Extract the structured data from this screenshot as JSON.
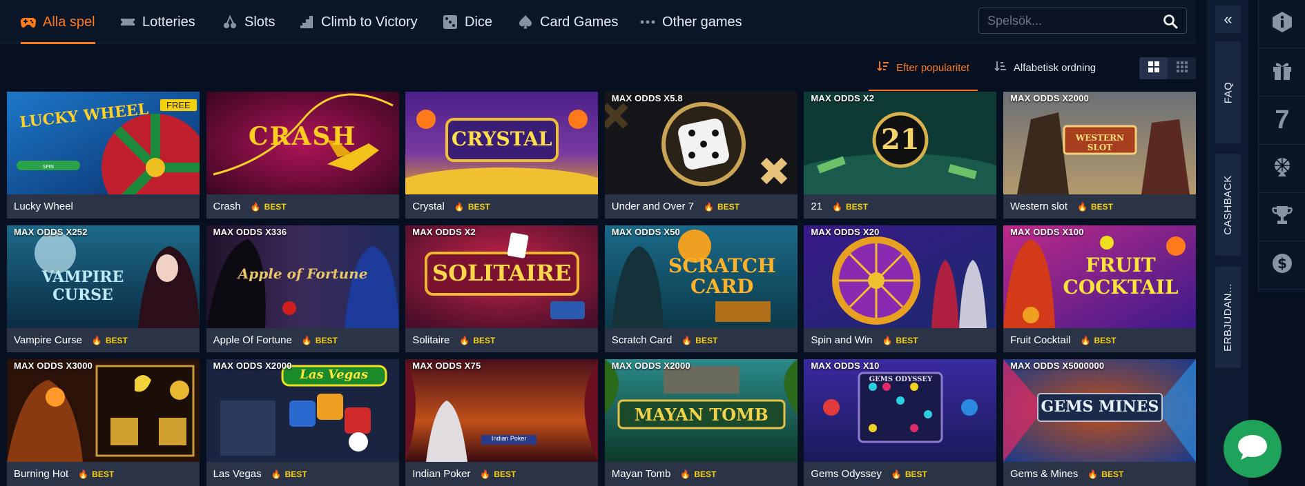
{
  "nav": {
    "tabs": [
      {
        "label": "Alla spel",
        "icon": "gamepad-icon",
        "active": true
      },
      {
        "label": "Lotteries",
        "icon": "ticket-icon"
      },
      {
        "label": "Slots",
        "icon": "cherries-icon"
      },
      {
        "label": "Climb to Victory",
        "icon": "stairs-icon"
      },
      {
        "label": "Dice",
        "icon": "dice-icon"
      },
      {
        "label": "Card Games",
        "icon": "spade-icon"
      },
      {
        "label": "Other games",
        "icon": "more-dots-icon"
      }
    ],
    "search_placeholder": "Spelsök..."
  },
  "sort": {
    "popularity": "Efter popularitet",
    "alphabetical": "Alfabetisk ordning"
  },
  "games": [
    {
      "name": "Lucky Wheel",
      "odds": "",
      "badge": "",
      "free": "FREE",
      "art": "LUCKY WHEEL"
    },
    {
      "name": "Crash",
      "odds": "",
      "badge": "BEST",
      "art": "CRASH"
    },
    {
      "name": "Crystal",
      "odds": "",
      "badge": "BEST",
      "art": "CRYSTAL"
    },
    {
      "name": "Under and Over 7",
      "odds": "MAX ODDS X5.8",
      "badge": "BEST",
      "art": ""
    },
    {
      "name": "21",
      "odds": "MAX ODDS X2",
      "badge": "BEST",
      "art": "21"
    },
    {
      "name": "Western slot",
      "odds": "MAX ODDS X2000",
      "badge": "BEST",
      "art": "WESTERN SLOT"
    },
    {
      "name": "Vampire Curse",
      "odds": "MAX ODDS X252",
      "badge": "BEST",
      "art": "VAMPIRE CURSE"
    },
    {
      "name": "Apple Of Fortune",
      "odds": "MAX ODDS X336",
      "badge": "BEST",
      "art": "Apple of Fortune"
    },
    {
      "name": "Solitaire",
      "odds": "MAX ODDS X2",
      "badge": "BEST",
      "art": "SOLITAIRE"
    },
    {
      "name": "Scratch Card",
      "odds": "MAX ODDS X50",
      "badge": "BEST",
      "art": "SCRATCH CARD"
    },
    {
      "name": "Spin and Win",
      "odds": "MAX ODDS X20",
      "badge": "BEST",
      "art": ""
    },
    {
      "name": "Fruit Cocktail",
      "odds": "MAX ODDS X100",
      "badge": "BEST",
      "art": "FRUIT COCKTAIL"
    },
    {
      "name": "Burning Hot",
      "odds": "MAX ODDS X3000",
      "badge": "BEST",
      "art": ""
    },
    {
      "name": "Las Vegas",
      "odds": "MAX ODDS X2000",
      "badge": "BEST",
      "art": "Las Vegas"
    },
    {
      "name": "Indian Poker",
      "odds": "MAX ODDS X75",
      "badge": "BEST",
      "art": "Indian Poker"
    },
    {
      "name": "Mayan Tomb",
      "odds": "MAX ODDS X2000",
      "badge": "BEST",
      "art": "MAYAN TOMB"
    },
    {
      "name": "Gems Odyssey",
      "odds": "MAX ODDS X10",
      "badge": "BEST",
      "art": "GEMS ODYSSEY"
    },
    {
      "name": "Gems & Mines",
      "odds": "MAX ODDS X5000000",
      "badge": "BEST",
      "art": "GEMS MINES"
    }
  ],
  "side": {
    "collapse": "«",
    "faq": "FAQ",
    "cashback": "CASHBACK",
    "offers": "ERBJUDAN...",
    "icons": [
      "info-icon",
      "gift-icon",
      "seven-icon",
      "wheel-icon",
      "trophy-icon",
      "dollar-icon"
    ],
    "seven": "7"
  },
  "colors": {
    "accent": "#ff7a1a",
    "best": "#f5d10c",
    "background": "#061021",
    "chat": "#1fa25a"
  }
}
